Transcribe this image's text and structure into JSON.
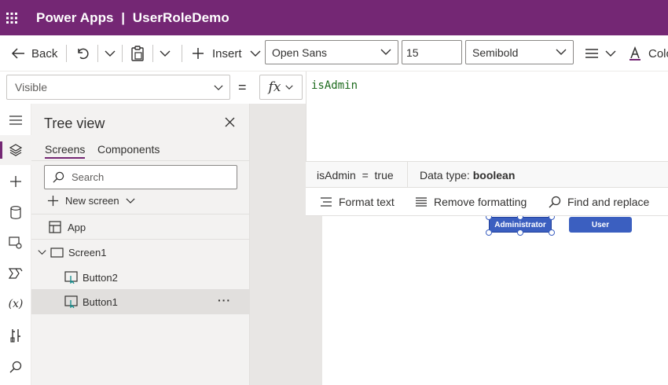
{
  "header": {
    "title": "Power Apps  |  UserRoleDemo"
  },
  "toolbar": {
    "back_label": "Back",
    "insert_label": "Insert",
    "font_family": "Open Sans",
    "font_size": "15",
    "font_weight": "Semibold",
    "color_label": "Colo"
  },
  "formula": {
    "property": "Visible",
    "equals": "=",
    "fx": "fx",
    "expression": "isAdmin",
    "result_text": "isAdmin  =  true",
    "datatype_label": "Data type:",
    "datatype_value": "boolean",
    "format_text": "Format text",
    "remove_formatting": "Remove formatting",
    "find_replace": "Find and replace"
  },
  "tree": {
    "title": "Tree view",
    "tabs": [
      "Screens",
      "Components"
    ],
    "search_placeholder": "Search",
    "new_screen": "New screen",
    "items": [
      "App",
      "Screen1",
      "Button2",
      "Button1"
    ],
    "more": "···"
  },
  "canvas": {
    "buttons": [
      "Administrator",
      "User"
    ]
  },
  "colors": {
    "brand": "#742774",
    "button": "#3b5fc0"
  }
}
